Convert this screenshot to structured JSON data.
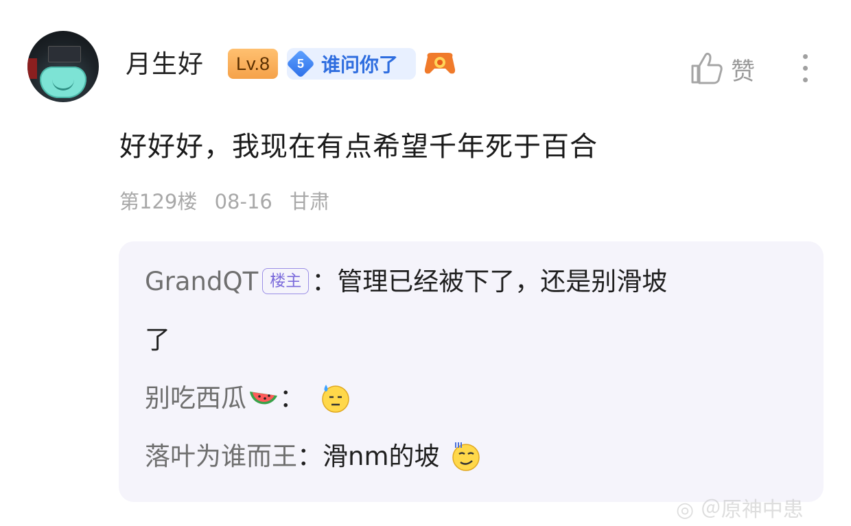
{
  "post": {
    "username": "月生好",
    "level": "Lv.8",
    "fans_level": "5",
    "fans_badge": "谁问你了",
    "like_label": "赞",
    "content": "好好好，我现在有点希望千年死于百合",
    "floor": "第129楼",
    "date": "08-16",
    "location": "甘肃"
  },
  "replies": [
    {
      "name": "GrandQT",
      "badge": "楼主",
      "sep": "：",
      "text_line1": "管理已经被下了，还是别滑坡",
      "text_line2": "了"
    },
    {
      "name": "别吃西瓜",
      "sep": "：",
      "emoji": "sweat-emoji"
    },
    {
      "name": "落叶为谁而王",
      "sep": "：",
      "text": "滑nm的坡",
      "emoji": "smirk-emoji"
    }
  ],
  "colors": {
    "fans_badge_text": "#2e6ddf",
    "level_badge": "#f5a24a",
    "owner_badge": "#7a6adb",
    "reply_background": "#f5f4fb",
    "meta_text": "#a8a8a8"
  }
}
